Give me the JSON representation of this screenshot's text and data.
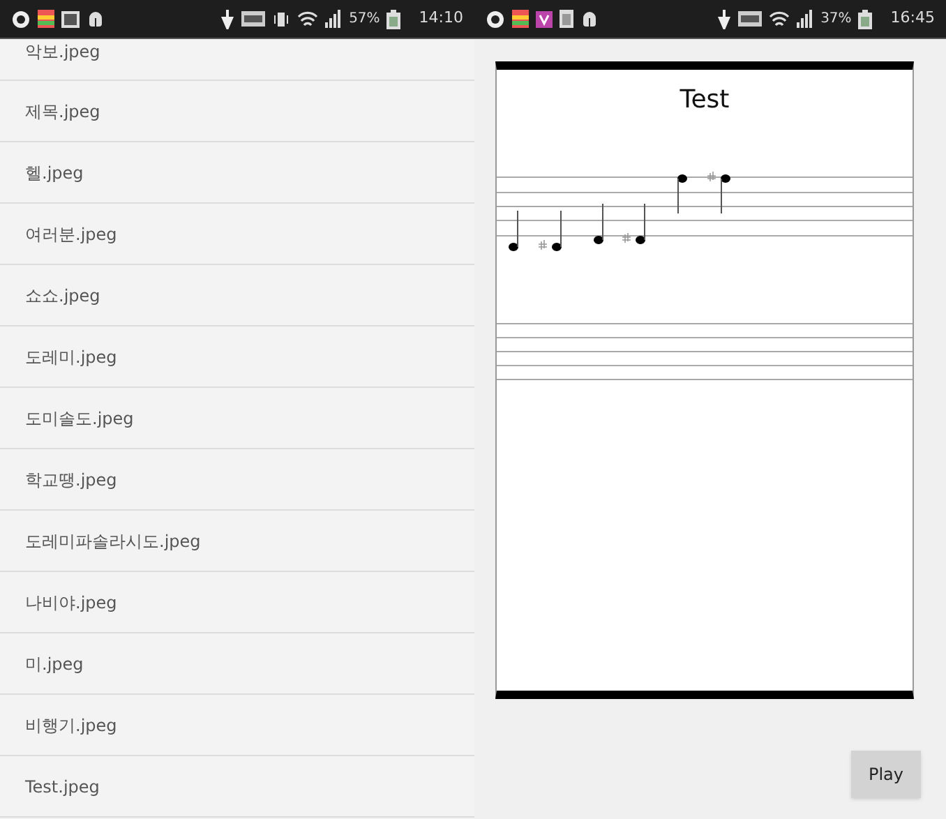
{
  "screens": [
    {
      "status_bar": {
        "battery": "57%",
        "time": "14:10"
      },
      "files": [
        "악보.jpeg",
        "제목.jpeg",
        "헬.jpeg",
        "여러분.jpeg",
        "쇼쇼.jpeg",
        "도레미.jpeg",
        "도미솔도.jpeg",
        "학교땡.jpeg",
        "도레미파솔라시도.jpeg",
        "나비야.jpeg",
        "미.jpeg",
        "비행기.jpeg",
        "Test.jpeg"
      ]
    },
    {
      "status_bar": {
        "battery": "37%",
        "time": "16:45"
      },
      "score": {
        "title": "Test"
      },
      "play_button": "Play"
    }
  ]
}
